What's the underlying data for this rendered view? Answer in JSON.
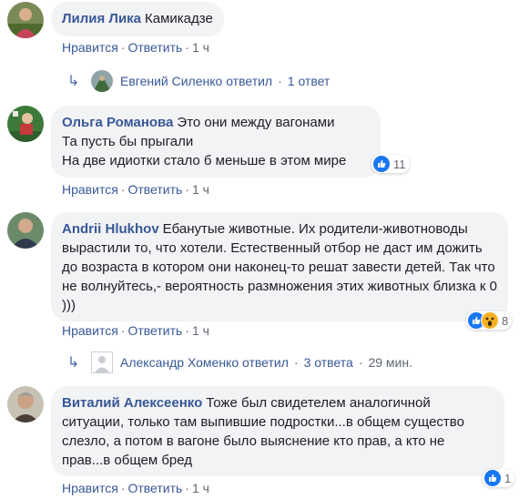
{
  "comments": [
    {
      "author": "Лилия Лика",
      "text": "Камикадзе",
      "actions": {
        "like": "Нравится",
        "reply": "Ответить",
        "time": "1 ч"
      },
      "replies": {
        "name": "Евгений Силенко ответил",
        "count": "1 ответ"
      }
    },
    {
      "author": "Ольга Романова",
      "text_lines": [
        "Это они между вагонами",
        "Та пусть бы прыгали",
        "На две идиотки стало б меньше в этом мире"
      ],
      "reactions": {
        "count": "11"
      },
      "actions": {
        "like": "Нравится",
        "reply": "Ответить",
        "time": "1 ч"
      }
    },
    {
      "author": "Andrii Hlukhov",
      "text": "Ебанутые животные. Их родители-животноводы вырастили то, что хотели. Естественный отбор не даст им дожить до возраста в котором они наконец-то решат завести детей. Так что не волнуйтесь,- вероятность размножения этих животных близка к 0 )))",
      "reactions": {
        "count": "8"
      },
      "actions": {
        "like": "Нравится",
        "reply": "Ответить",
        "time": "1 ч"
      },
      "replies": {
        "name": "Александр Хоменко ответил",
        "count": "3 ответа",
        "time": "29 мин."
      }
    },
    {
      "author": "Виталий Алексеенко",
      "text": "Тоже был свидетелем аналогичной ситуации, только там выпившие подростки...в общем существо слезло, а потом в вагоне было выяснение кто прав, а кто не прав...в общем бред",
      "reactions": {
        "count": "1"
      },
      "actions": {
        "like": "Нравится",
        "reply": "Ответить",
        "time": "1 ч"
      }
    }
  ],
  "colors": {
    "link": "#385898",
    "bubble": "#f2f3f5",
    "meta": "#606770",
    "like": "#1877f2",
    "wow": "#f7b125"
  },
  "icons": [
    "like-icon",
    "wow-icon",
    "reply-arrow-icon"
  ]
}
